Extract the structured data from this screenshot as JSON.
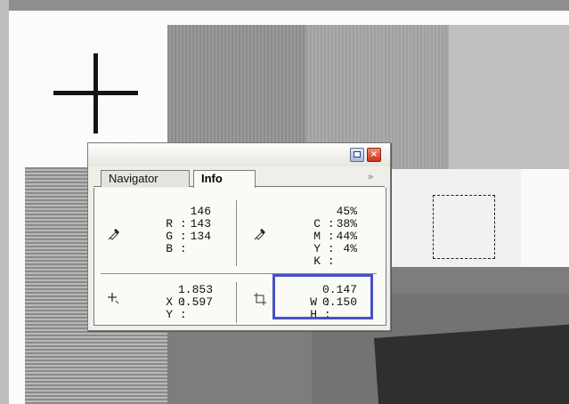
{
  "panel": {
    "tabs": [
      {
        "label": "Navigator",
        "active": false
      },
      {
        "label": "Info",
        "active": true
      }
    ],
    "expand_glyph": "»",
    "minimize_icon": "minimize-icon",
    "close_icon": "close-icon",
    "close_glyph": "×"
  },
  "color_readout": {
    "rgb_icon": "eyedropper-icon",
    "rgb": [
      {
        "label": "R",
        "value": "146"
      },
      {
        "label": "G",
        "value": "143"
      },
      {
        "label": "B",
        "value": "134"
      }
    ],
    "cmyk_icon": "eyedropper-icon",
    "cmyk": [
      {
        "label": "C",
        "value": "45%"
      },
      {
        "label": "M",
        "value": "38%"
      },
      {
        "label": "Y",
        "value": "44%"
      },
      {
        "label": "K",
        "value": "4%"
      }
    ]
  },
  "position_readout": {
    "icon": "crosshair-icon",
    "x_label": "X",
    "x_value": "1.853",
    "y_label": "Y",
    "y_value": "0.597"
  },
  "size_readout": {
    "icon": "marquee-size-icon",
    "w_label": "W",
    "w_value": "0.147",
    "h_label": "H",
    "h_value": "0.150"
  },
  "colors": {
    "highlight_border": "#4652c6",
    "panel_bg": "#efefe9"
  }
}
